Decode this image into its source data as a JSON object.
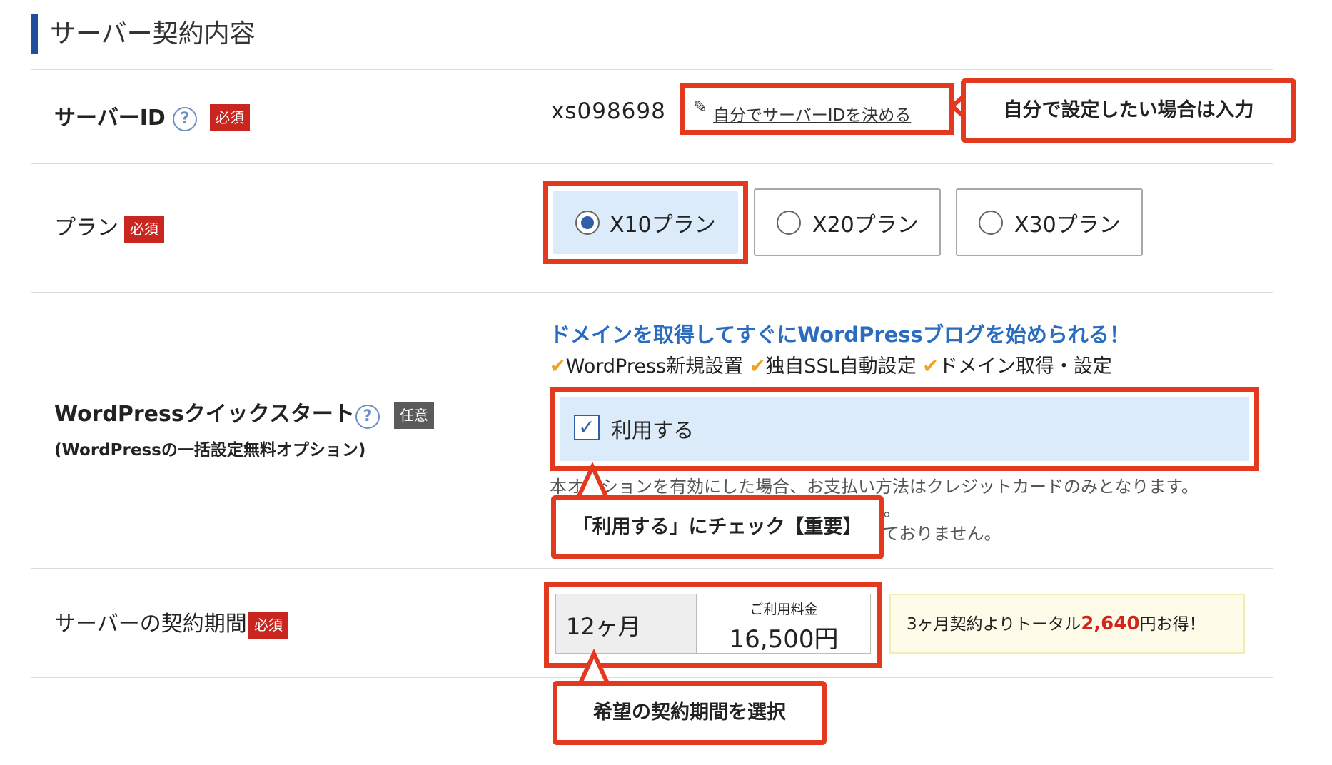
{
  "section": {
    "title": "サーバー契約内容"
  },
  "server_id": {
    "label": "サーバーID",
    "help": "?",
    "badge": "必須",
    "value": "xs098698",
    "link_label": "自分でサーバーIDを決める",
    "callout": "自分で設定したい場合は入力"
  },
  "plan": {
    "label": "プラン",
    "badge": "必須",
    "options": [
      {
        "label": "X10プラン",
        "selected": true
      },
      {
        "label": "X20プラン",
        "selected": false
      },
      {
        "label": "X30プラン",
        "selected": false
      }
    ]
  },
  "wordpress": {
    "label": "WordPressクイックスタート",
    "help": "?",
    "badge": "任意",
    "sublabel": "(WordPressの一括設定無料オプション)",
    "headline": "ドメインを取得してすぐにWordPressブログを始められる！",
    "features": [
      "WordPress新規設置",
      "独自SSL自動設定",
      "ドメイン取得・設定"
    ],
    "checkbox_label": "利用する",
    "checked": true,
    "note_line1": "本オプションを有効にした場合、お支払い方法はクレジットカードのみとなります。",
    "note_line2": "す。",
    "note_line3": "ておりません。",
    "callout": "「利用する」にチェック【重要】"
  },
  "period": {
    "label": "サーバーの契約期間",
    "badge": "必須",
    "select_value": "12ヶ月",
    "fee_label": "ご利用料金",
    "fee_value": "16,500円",
    "promo_prefix": "3ヶ月契約よりトータル",
    "promo_amount": "2,640",
    "promo_suffix": "円お得！",
    "callout": "希望の契約期間を選択"
  },
  "colors": {
    "accent_red": "#e3391f",
    "badge_red": "#c8261e",
    "brand_blue": "#1f4f9c",
    "selected_bg": "#dcebfa",
    "check_orange": "#f0a21a"
  }
}
